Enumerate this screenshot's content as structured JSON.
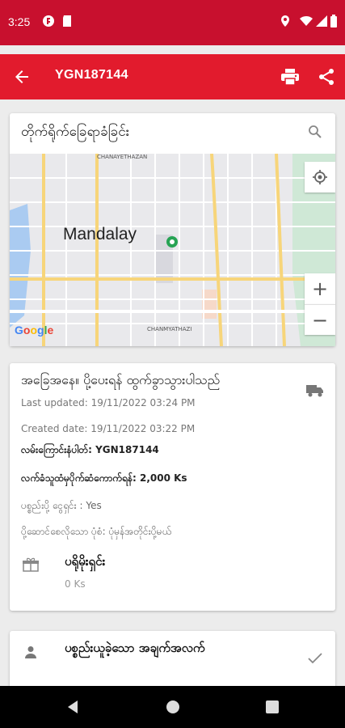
{
  "status_bar": {
    "time": "3:25"
  },
  "app_bar": {
    "title": "YGN187144"
  },
  "tracking_card": {
    "title": "တိုက်ရိုက်ခြေရာခံခြင်း",
    "map": {
      "city_label": "Mandalay",
      "street_top": "CHANAYETHAZAN",
      "street_bottom": "CHANMYATHAZI",
      "google_letters": [
        "G",
        "o",
        "o",
        "g",
        "l",
        "e"
      ],
      "google_colors": [
        "#4285F4",
        "#EA4335",
        "#FBBC05",
        "#4285F4",
        "#34A853",
        "#EA4335"
      ],
      "zoom_in": "+",
      "zoom_out": "−"
    }
  },
  "status_card": {
    "title": "အခြေအနေ။ ပို့ပေးရန် ထွက်ခွာသွားပါသည်",
    "last_updated": "Last updated: 19/11/2022 03:24 PM",
    "created_date": "Created date: 19/11/2022 03:22 PM",
    "tracking_line": "လမ်းကြောင်းနံပါတ်: YGN187144",
    "fee_line": "လက်ခံသူထံမှပိုက်ဆံကောက်ရန်: 2,000 Ks",
    "paid_line": "ပစ္စည်းပို့ ငွေရှင်း : Yes",
    "type_line": "ပို့ဆောင်စေလိုသော ပုံစံ: ပုံမှန်အတိုင်းပို့မယ်",
    "parcel_label": "ပရိုမိုးရှင်း",
    "parcel_value": "0 Ks"
  },
  "receiver_card": {
    "title": "ပစ္စည်းယူခဲ့သော အချက်အလက်"
  },
  "colors": {
    "primary": "#e21b2d",
    "status_bar": "#c8102e"
  }
}
